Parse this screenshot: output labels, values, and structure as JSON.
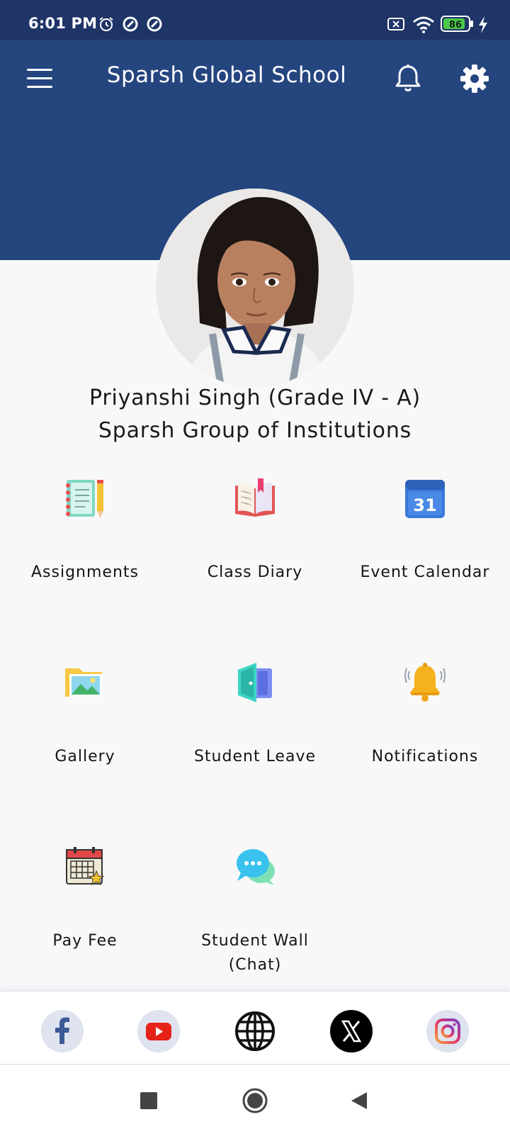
{
  "status_bar": {
    "time": "6:01 PM",
    "battery": "86"
  },
  "header": {
    "title": "Sparsh Global School"
  },
  "profile": {
    "name_line": "Priyanshi Singh (Grade IV - A)",
    "org_line": "Sparsh Group of Institutions"
  },
  "menu": {
    "assignments": "Assignments",
    "class_diary": "Class Diary",
    "event_calendar": "Event Calendar",
    "calendar_day": "31",
    "gallery": "Gallery",
    "student_leave": "Student Leave",
    "notifications": "Notifications",
    "pay_fee": "Pay Fee",
    "student_wall_1": "Student Wall",
    "student_wall_2": "(Chat)"
  },
  "social": [
    "facebook-icon",
    "youtube-icon",
    "globe-icon",
    "x-icon",
    "instagram-icon"
  ],
  "colors": {
    "header": "#25457f",
    "status_bar": "#1f3568",
    "background": "#f8f8f9"
  }
}
